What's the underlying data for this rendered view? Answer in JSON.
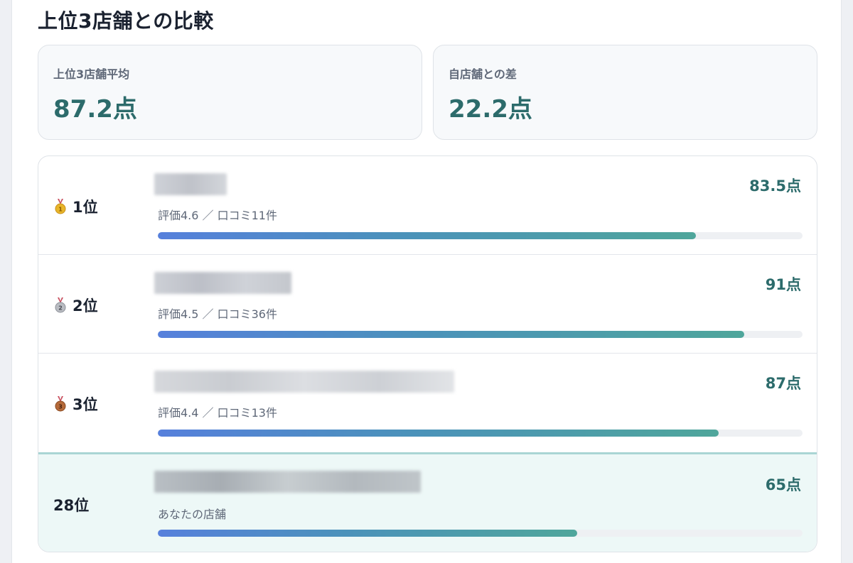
{
  "section": {
    "title": "上位3店舗との比較"
  },
  "stats": [
    {
      "label": "上位3店舗平均",
      "value": "87.2点"
    },
    {
      "label": "自店舗との差",
      "value": "22.2点"
    }
  ],
  "rows": [
    {
      "rank": "1位",
      "medal": "gold-medal-icon",
      "meta": "評価4.6 ／ 口コミ11件",
      "score": "83.5点",
      "progress": 0.835
    },
    {
      "rank": "2位",
      "medal": "silver-medal-icon",
      "meta": "評価4.5 ／ 口コミ36件",
      "score": "91点",
      "progress": 0.91
    },
    {
      "rank": "3位",
      "medal": "bronze-medal-icon",
      "meta": "評価4.4 ／ 口コミ13件",
      "score": "87点",
      "progress": 0.87
    }
  ],
  "mine": {
    "rank": "28位",
    "meta": "あなたの店舗",
    "score": "65点",
    "progress": 0.65
  },
  "colors": {
    "accent": "#2c6b6b",
    "bar_start": "#5680dc",
    "bar_end": "#4fa69b",
    "highlight_bg": "#edf8f7"
  }
}
